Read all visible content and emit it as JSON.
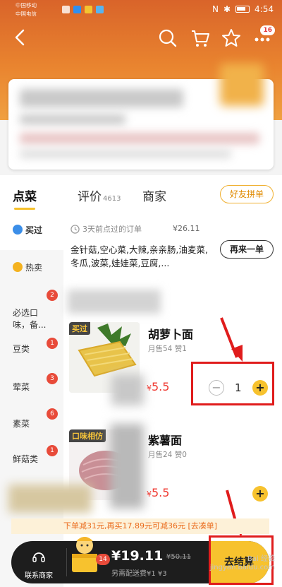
{
  "status_bar": {
    "carrier1": "中国移动",
    "carrier2": "中国电信",
    "time": "4:54"
  },
  "nav": {
    "cart_badge": "16"
  },
  "tabs": [
    {
      "label": "点菜",
      "count": ""
    },
    {
      "label": "评价",
      "count": "4613"
    },
    {
      "label": "商家",
      "count": ""
    }
  ],
  "group_order": "好友拼单",
  "sidebar": [
    {
      "label": "买过",
      "badge": ""
    },
    {
      "label": "热卖",
      "badge": ""
    },
    {
      "label": "必选口\n味，备...",
      "badge": "2"
    },
    {
      "label": "豆类",
      "badge": "1"
    },
    {
      "label": "荤菜",
      "badge": "3"
    },
    {
      "label": "素菜",
      "badge": "6"
    },
    {
      "label": "鲜菇类",
      "badge": "1"
    }
  ],
  "past_order": {
    "when": "3天前点过的订单",
    "price": "¥26.11",
    "items": "金针菇,空心菜,大辣,亲亲肠,油麦菜,冬瓜,波菜,娃娃菜,豆腐,...",
    "reorder": "再来一单"
  },
  "foods": [
    {
      "tag": "买过",
      "name": "胡萝卜面",
      "sales": "月售54",
      "likes": "赞1",
      "price_symbol": "¥",
      "price": "5.5",
      "qty": "1"
    },
    {
      "tag": "口味相仿",
      "name": "紫薯面",
      "sales": "月售24",
      "likes": "赞0",
      "price_symbol": "¥",
      "price": "5.5",
      "qty": ""
    }
  ],
  "promo": "下单减31元,再买17.89元可减36元 [去凑单]",
  "cart": {
    "contact": "联系商家",
    "badge": "14",
    "total": "¥19.11",
    "original": "¥50.11",
    "delivery": "另需配送费¥1 ¥3",
    "checkout": "去结算"
  },
  "watermark": "Bai 经验\njingyan.baidu.com",
  "colors": {
    "accent": "#f7c22e",
    "header": "#e9842f",
    "price": "#ef3a32",
    "highlight_box": "#e01c1c"
  }
}
